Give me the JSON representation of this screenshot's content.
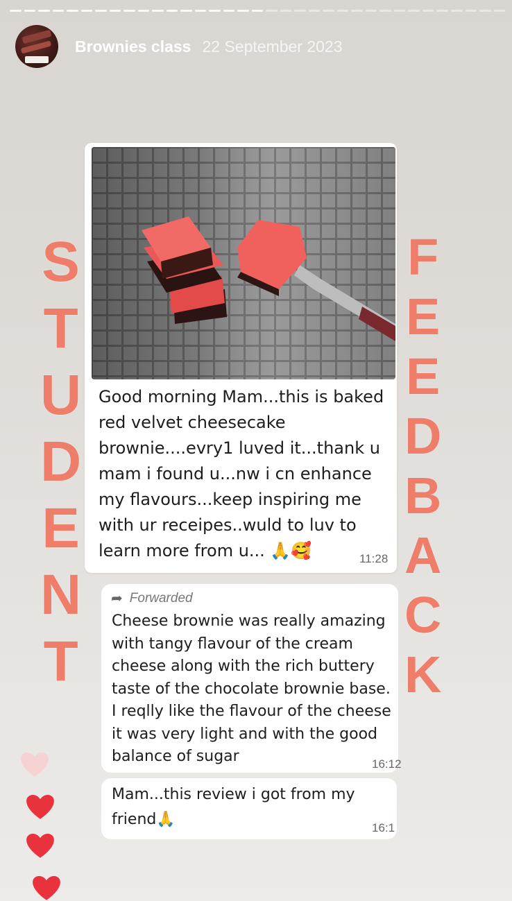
{
  "story": {
    "account_name": "Brownies class",
    "date": "22 September 2023"
  },
  "overlay": {
    "left_word": [
      "S",
      "T",
      "U",
      "D",
      "E",
      "N",
      "T"
    ],
    "right_word": [
      "F",
      "E",
      "E",
      "D",
      "B",
      "A",
      "C",
      "K"
    ],
    "accent_color": "#ee7e6a"
  },
  "messages": [
    {
      "text": "Good morning Mam...this is baked red velvet cheesecake brownie....evry1 luved it...thank u mam i found u...nw i cn enhance my flavours...keep inspiring me with ur receipes..wuld to luv to learn more from u... 🙏🥰",
      "time": "11:28"
    },
    {
      "forwarded_label": "Forwarded",
      "text": "Cheese brownie was really amazing with tangy flavour of the cream cheese along with the rich buttery taste of the chocolate brownie base. I reqlly like the flavour of the cheese it was very light and with the good balance of sugar",
      "time": "16:12"
    },
    {
      "text": "Mam...this review i got from my friend🙏",
      "time": "16:1"
    }
  ],
  "reactions": {
    "heart_color": "#e8333c",
    "faded_heart_color": "#f6d2d3"
  }
}
